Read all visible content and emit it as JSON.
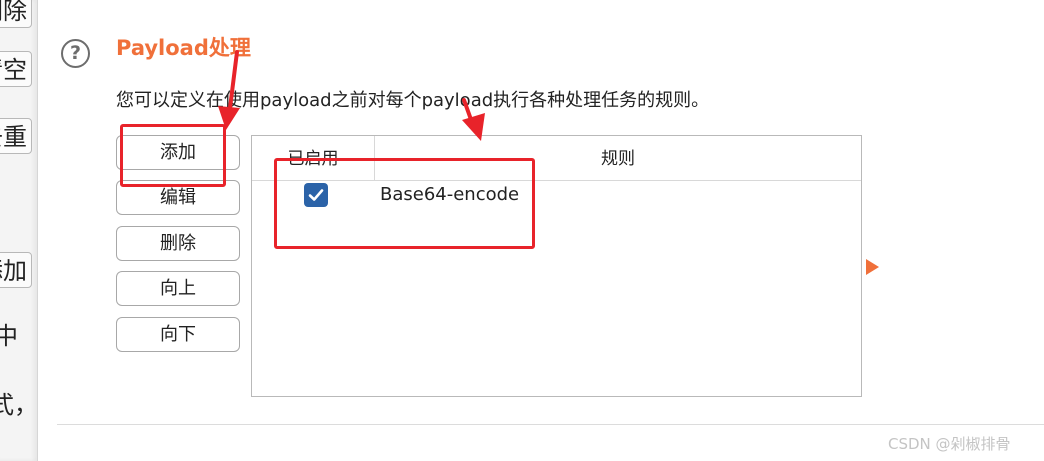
{
  "left_panel": {
    "buttons": [
      "删除",
      "清空",
      "去重",
      "添加"
    ],
    "texts": [
      "中"
    ]
  },
  "header": {
    "help_icon": "question-circle-icon",
    "title": "Payload处理",
    "description": "您可以定义在使用payload之前对每个payload执行各种处理任务的规则。"
  },
  "buttons": {
    "add": "添加",
    "edit": "编辑",
    "delete": "删除",
    "up": "向上",
    "down": "向下"
  },
  "table": {
    "columns": [
      "已启用",
      "规则"
    ],
    "rows": [
      {
        "enabled": true,
        "rule": "Base64-encode"
      }
    ]
  },
  "watermark": "CSDN @剁椒排骨",
  "colors": {
    "accent": "#f0703a",
    "annotation": "#e8232a",
    "checkbox": "#2b63a8"
  }
}
